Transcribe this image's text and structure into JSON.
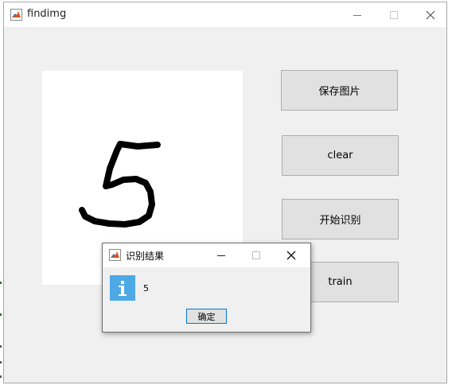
{
  "window": {
    "title": "findimg",
    "icon": "matlab-icon"
  },
  "canvas": {
    "drawn_digit": "5"
  },
  "buttons": {
    "save_image": "保存图片",
    "clear": "clear",
    "start_recognition": "开始识别",
    "train": "train"
  },
  "dialog": {
    "title": "识别结果",
    "icon": "info-icon",
    "message": "5",
    "ok_label": "确定"
  },
  "colors": {
    "window_bg": "#f0f0f0",
    "button_bg": "#e1e1e1",
    "info_blue": "#4ca9e6",
    "focus_blue": "#0078d7"
  }
}
